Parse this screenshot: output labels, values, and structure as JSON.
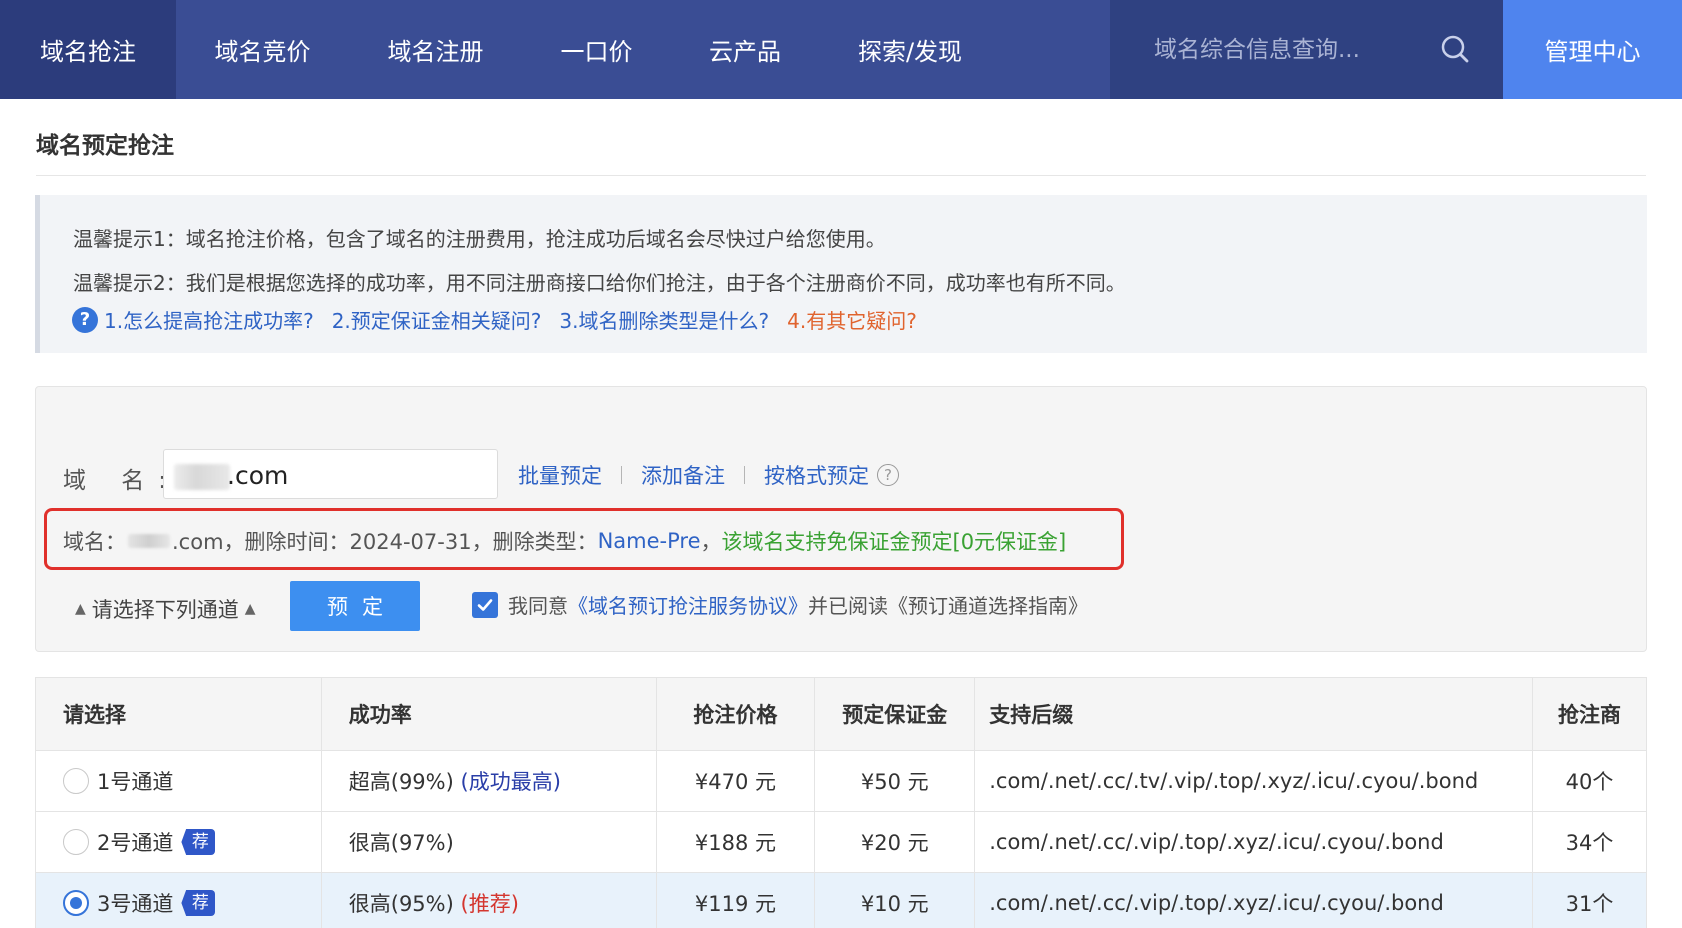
{
  "nav": {
    "items": [
      "域名抢注",
      "域名竞价",
      "域名注册",
      "一口价",
      "云产品",
      "探索/发现"
    ],
    "search_placeholder": "域名综合信息查询...",
    "admin": "管理中心"
  },
  "page": {
    "title": "域名预定抢注"
  },
  "tips": {
    "tip1": "温馨提示1：域名抢注价格，包含了域名的注册费用，抢注成功后域名会尽快过户给您使用。",
    "tip2": "温馨提示2：我们是根据您选择的成功率，用不同注册商接口给你们抢注，由于各个注册商价不同，成功率也有所不同。",
    "help_icon": "?",
    "links": [
      "1.怎么提高抢注成功率?",
      "2.预定保证金相关疑问?",
      "3.域名删除类型是什么?",
      "4.有其它疑问?"
    ]
  },
  "form": {
    "domain_label": "域 名:",
    "domain_value": ".com",
    "actions": [
      "批量预定",
      "添加备注",
      "按格式预定"
    ],
    "help_icon": "?",
    "info": {
      "prefix": "域名：",
      "domain_suffix": ".com，删除时间：2024-07-31，删除类型：",
      "delete_type": "Name-Pre",
      "comma": "，",
      "note": "该域名支持免保证金预定[0元保证金]"
    },
    "channel_select": "请选择下列通道",
    "tri_icon": "▲",
    "reserve_button": "预定",
    "agree_prefix": "我同意",
    "agree_link": "《域名预订抢注服务协议》",
    "agree_suffix": "并已阅读《预订通道选择指南》"
  },
  "table": {
    "headers": [
      "请选择",
      "成功率",
      "抢注价格",
      "预定保证金",
      "支持后缀",
      "抢注商"
    ],
    "rows": [
      {
        "channel": "1号通道",
        "rate": "超高(99%)",
        "rate_note": "(成功最高)",
        "price": "¥470 元",
        "deposit": "¥50 元",
        "suffixes": ".com/.net/.cc/.tv/.vip/.top/.xyz/.icu/.cyou/.bond",
        "count": "40个",
        "badge": ""
      },
      {
        "channel": "2号通道",
        "rate": "很高(97%)",
        "rate_note": "",
        "price": "¥188 元",
        "deposit": "¥20 元",
        "suffixes": ".com/.net/.cc/.vip/.top/.xyz/.icu/.cyou/.bond",
        "count": "34个",
        "badge": "荐"
      },
      {
        "channel": "3号通道",
        "rate": "很高(95%)",
        "rate_note": "(推荐)",
        "price": "¥119 元",
        "deposit": "¥10 元",
        "suffixes": ".com/.net/.cc/.vip/.top/.xyz/.icu/.cyou/.bond",
        "count": "31个",
        "badge": "荐"
      }
    ]
  },
  "icons": {
    "search": "search-icon",
    "help": "question-circle-icon",
    "check": "checkmark-icon",
    "triangle": "triangle-up-icon"
  },
  "colors": {
    "nav_bg": "#3a4d94",
    "admin_bg": "#4f84ee",
    "link": "#2f63c5",
    "price_red": "#d4362f",
    "green": "#3aa233",
    "highlight_border": "#e0302b"
  }
}
